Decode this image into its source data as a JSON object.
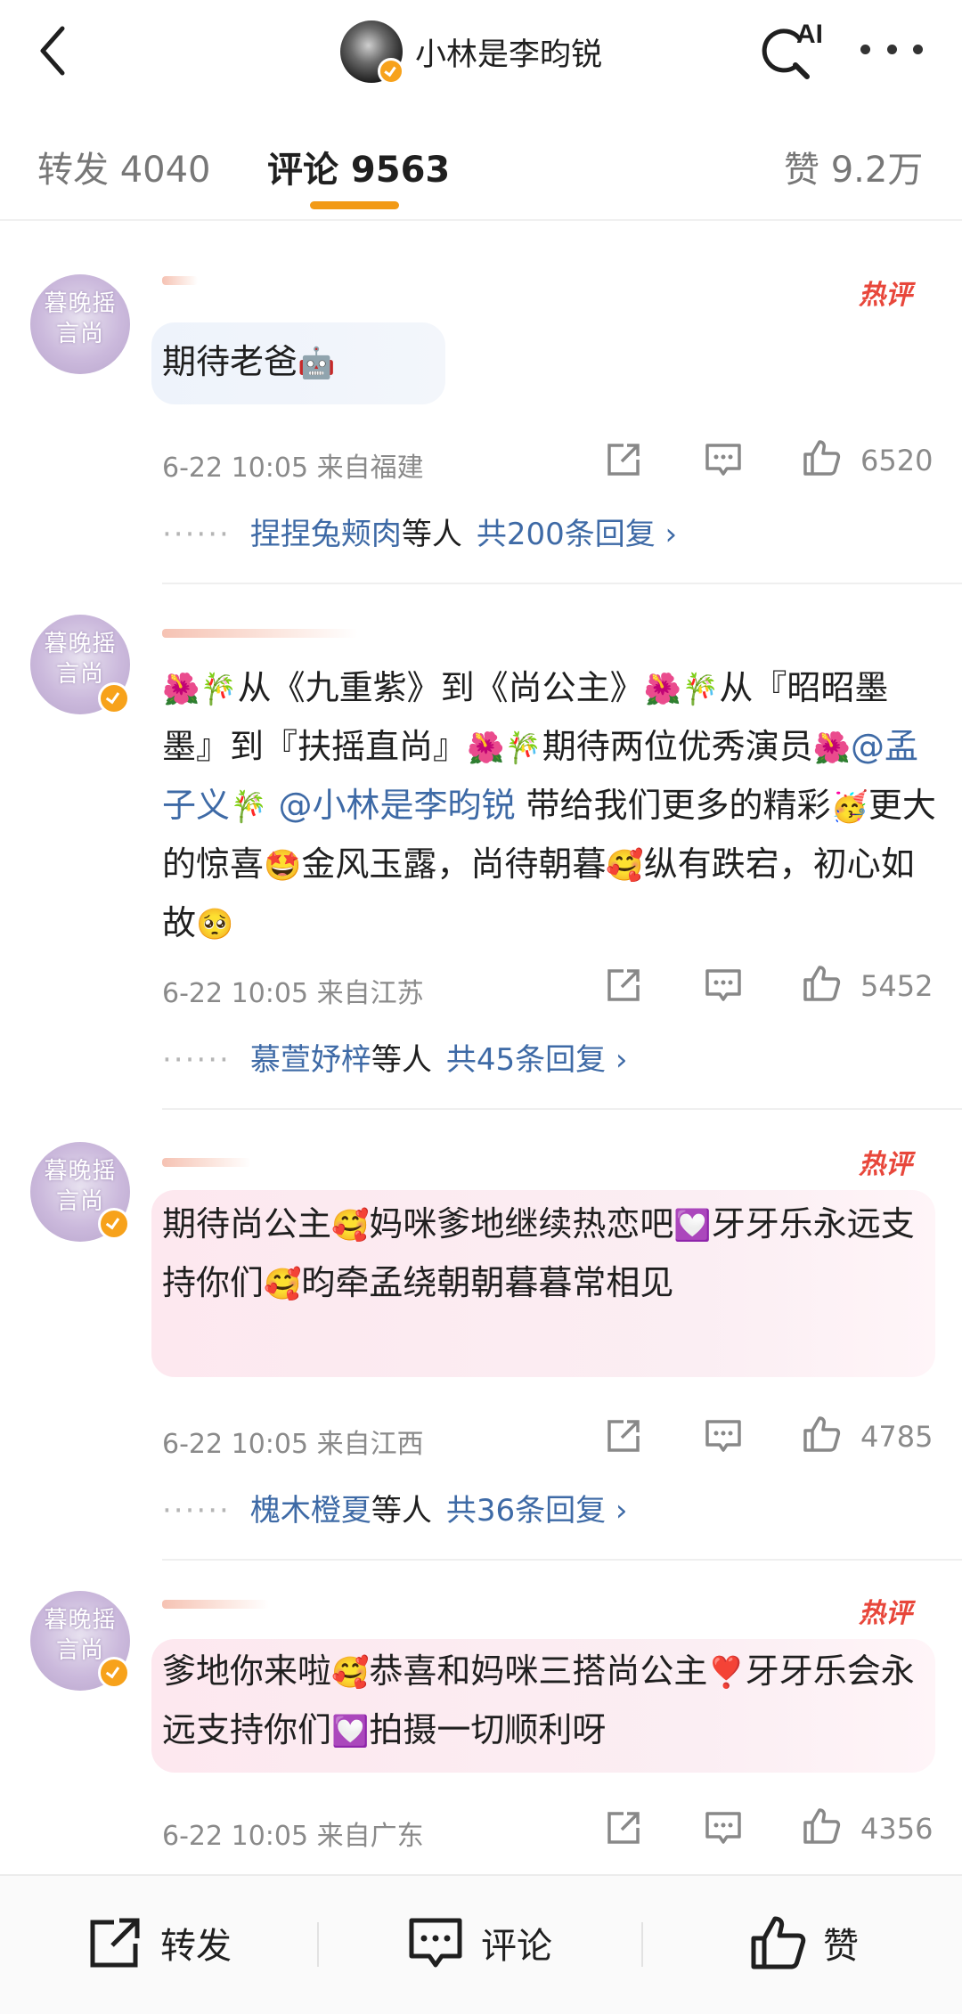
{
  "header": {
    "username": "小林是李昀锐",
    "ai_label": "AI"
  },
  "tabs": {
    "repost": "转发 4040",
    "comments": "评论 9563",
    "likes": "赞 9.2万"
  },
  "comments": [
    {
      "avatar_text": "暮晚摇\n言尚",
      "hot_label": "热评",
      "text": "期待老爸",
      "emoji": "🤖",
      "time": "6-22 10:05",
      "location": "来自福建",
      "likes": "6520",
      "reply_names": "捏捏兔颊肉",
      "reply_mid": "等人",
      "reply_count": "共200条回复 ›"
    },
    {
      "avatar_text": "暮晚摇\n言尚",
      "text_parts": {
        "p1": "从《九重紫》到《尚公主》",
        "p2": "从『昭昭墨墨』到『扶摇直尚』",
        "p3": "期待两位优秀演员",
        "mention1": "@孟子义",
        "mention2": "@小林是李昀锐",
        "p4": " 带给我们更多的精彩",
        "p5": "更大的惊喜",
        "p6": "金风玉露，尚待朝暮",
        "p7": "纵有跌宕，初心如故"
      },
      "time": "6-22 10:05",
      "location": "来自江苏",
      "likes": "5452",
      "reply_names": "慕萱妤梓",
      "reply_mid": "等人",
      "reply_count": "共45条回复 ›"
    },
    {
      "avatar_text": "暮晚摇\n言尚",
      "hot_label": "热评",
      "text_parts": {
        "p1": "期待尚公主",
        "p2": "妈咪爹地继续热恋吧",
        "p3": "牙牙乐永远支持你们",
        "p4": "昀牵孟绕朝朝暮暮常相见"
      },
      "time": "6-22 10:05",
      "location": "来自江西",
      "likes": "4785",
      "reply_names": "槐木橙夏",
      "reply_mid": "等人",
      "reply_count": "共36条回复 ›"
    },
    {
      "avatar_text": "暮晚摇\n言尚",
      "hot_label": "热评",
      "text_parts": {
        "p1": "爹地你来啦",
        "p2": "恭喜和妈咪三搭尚公主",
        "p3": "牙牙乐会永远支持你们",
        "p4": "拍摄一切顺利呀"
      },
      "time": "6-22 10:05",
      "location": "来自广东",
      "likes": "4356"
    }
  ],
  "bottom_bar": {
    "repost": "转发",
    "comment": "评论",
    "like": "赞"
  },
  "colors": {
    "accent": "#f29a16",
    "link": "#3e6aa6",
    "hot": "#e8473b",
    "verified": "#f7a21b"
  }
}
